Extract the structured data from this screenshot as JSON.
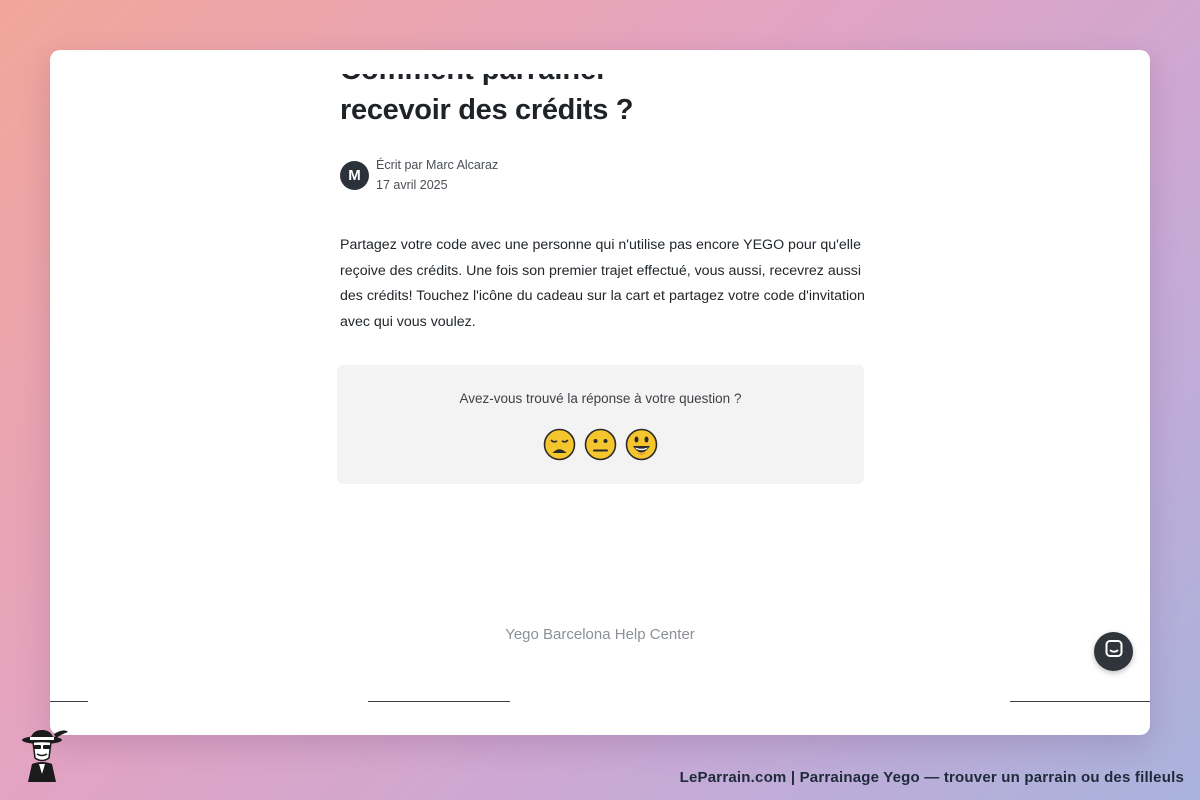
{
  "article": {
    "title_line_clipped": "Comment parrainer quelqu'un pour",
    "title_line": "recevoir des crédits ?",
    "author": {
      "initial": "M",
      "byline": "Écrit par Marc Alcaraz",
      "date": "17 avril 2025"
    },
    "body": "Partagez votre code avec une personne qui n'utilise pas encore YEGO pour qu'elle reçoive des crédits. Une fois son premier trajet effectué, vous aussi, recevrez aussi des crédits! Touchez l'icône du cadeau sur la cart et partagez votre code d'invitation avec qui vous voulez."
  },
  "feedback": {
    "question": "Avez-vous trouvé la réponse à votre question ?",
    "reactions": [
      "disappointed-face-icon",
      "neutral-face-icon",
      "smiley-face-icon"
    ]
  },
  "footer": {
    "brand": "Yego Barcelona Help Center"
  },
  "chat": {
    "icon": "chat-bubble-icon"
  },
  "caption": {
    "text": "LeParrain.com | Parrainage Yego — trouver un parrain ou des filleuls",
    "logo": "detective-mascot-icon"
  },
  "colors": {
    "text_dark": "#1f2328",
    "avatar_bg": "#2b323a",
    "feedback_bg": "#f3f3f3",
    "footer_text": "#8c9196",
    "emoji_yellow": "#f5c52e"
  }
}
